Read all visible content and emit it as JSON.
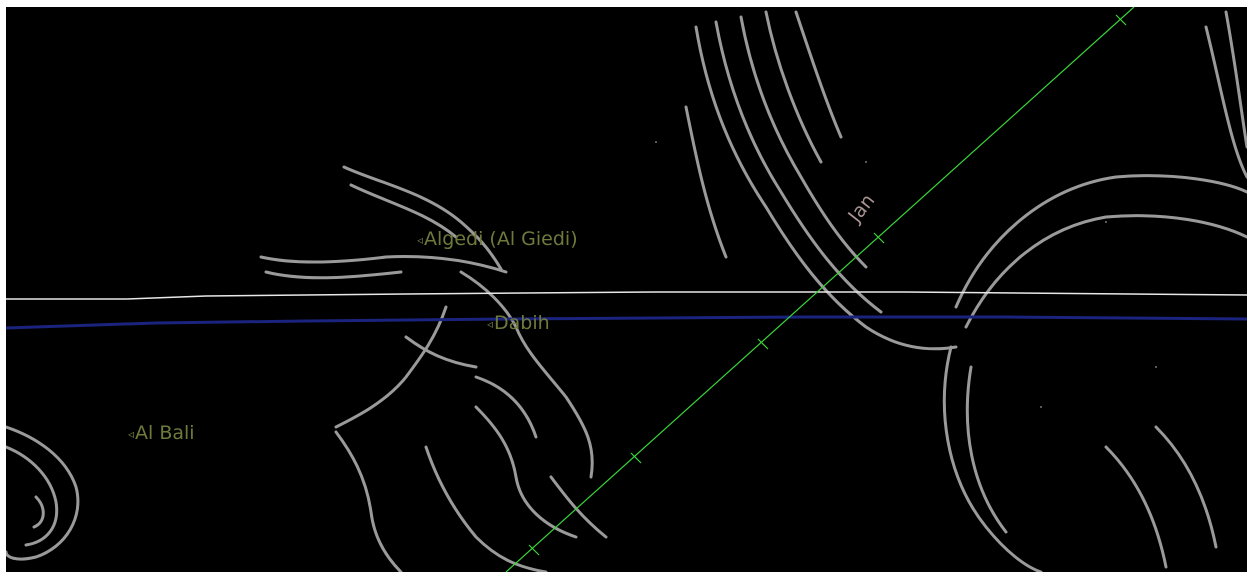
{
  "sky": {
    "background": "#000000",
    "artwork": "capricornus-constellation-art",
    "lines": {
      "horizon_color": "#e8e8e8",
      "celestial_equator_color": "#1a237e",
      "ecliptic_color": "#3ad43a"
    },
    "stars": [
      {
        "name": "Algedi (Al Giedi)",
        "marker": "◃"
      },
      {
        "name": "Dabih",
        "marker": "◃"
      },
      {
        "name": "Al Bali",
        "marker": "◃"
      }
    ],
    "ecliptic_month_label": "Jan",
    "label_color": "#6e7a3c",
    "month_label_color": "#a89292"
  }
}
